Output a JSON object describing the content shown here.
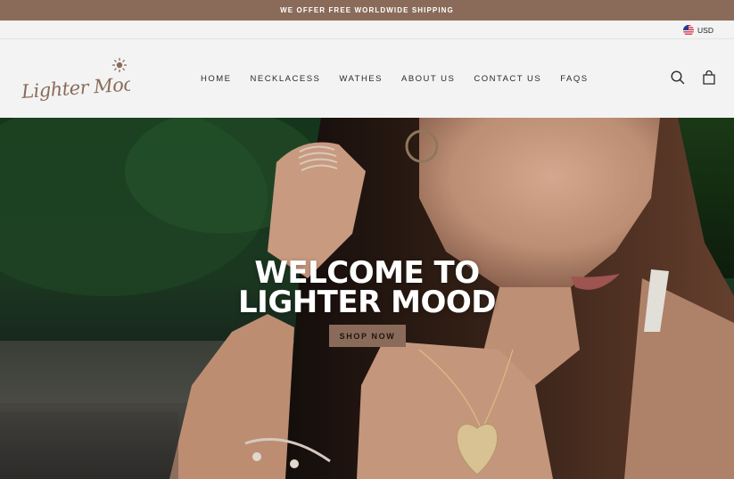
{
  "announcement": {
    "text": "WE OFFER FREE WORLDWIDE SHIPPING"
  },
  "toolbar": {
    "currency": "USD",
    "currency_icon": "us-flag-icon"
  },
  "header": {
    "logo_text": "Lighter Mood",
    "nav": [
      "HOME",
      "NECKLACESS",
      "WATHES",
      "ABOUT US",
      "CONTACT US",
      "FAQS"
    ],
    "icons": [
      "search-icon",
      "cart-icon"
    ]
  },
  "hero": {
    "title_line1": "WELCOME TO",
    "title_line2": "LIGHTER MOOD",
    "cta_label": "SHOP NOW"
  },
  "colors": {
    "brand": "#8a6b5a",
    "header_bg": "#f3f3f3",
    "text": "#1c1d1d",
    "hero_text": "#ffffff"
  }
}
